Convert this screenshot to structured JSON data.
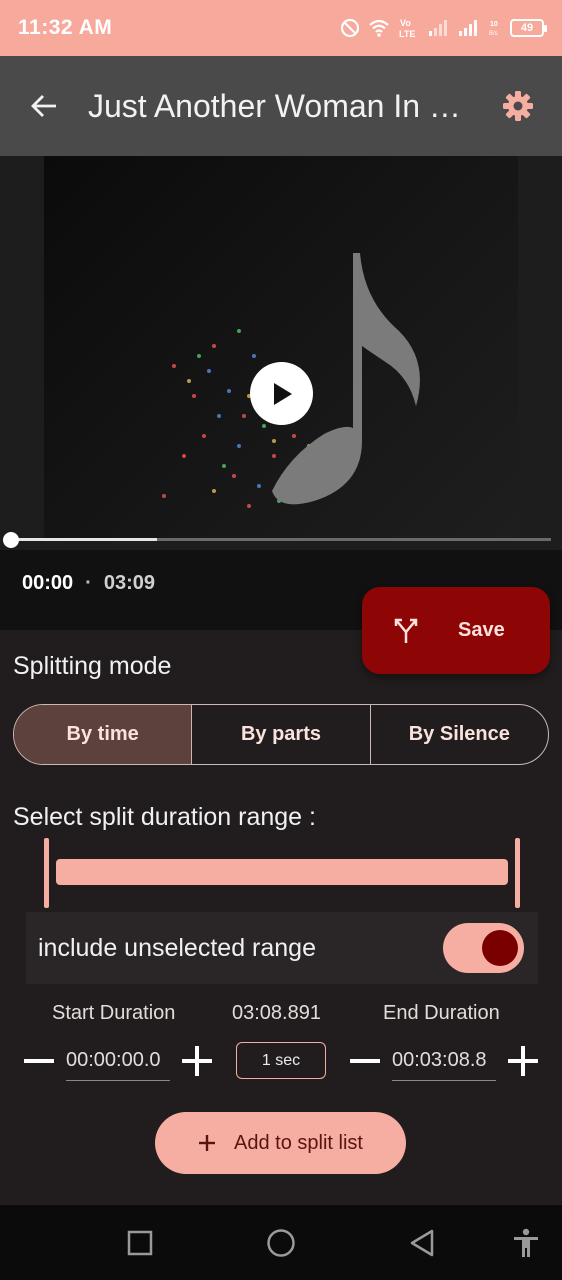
{
  "status_bar": {
    "time": "11:32 AM",
    "battery": "49"
  },
  "app_bar": {
    "title": "Just Another Woman In Love",
    "back_icon": "arrow-left-icon",
    "settings_icon": "gear-icon"
  },
  "player": {
    "current_time": "00:00",
    "separator": "·",
    "total_time": "03:09",
    "progress_fraction": 0.27,
    "play_icon": "play-icon"
  },
  "save_button": {
    "label": "Save",
    "icon": "split-icon",
    "color": "#8e0505"
  },
  "splitting_mode": {
    "title": "Splitting mode",
    "options": [
      "By time",
      "By parts",
      "By Silence"
    ],
    "selected": "By time"
  },
  "range": {
    "title": "Select split duration range :",
    "include_label": "include unselected range",
    "include_enabled": true
  },
  "durations": {
    "start_label": "Start Duration",
    "total": "03:08.891",
    "end_label": "End Duration",
    "start_value": "00:00:00.0",
    "step": "1 sec",
    "end_value": "00:03:08.8"
  },
  "add_button": {
    "label": "Add to split list",
    "icon": "plus-icon"
  },
  "colors": {
    "accent": "#f6aea2",
    "status_bar": "#f7a99c",
    "background": "#211d1e"
  }
}
